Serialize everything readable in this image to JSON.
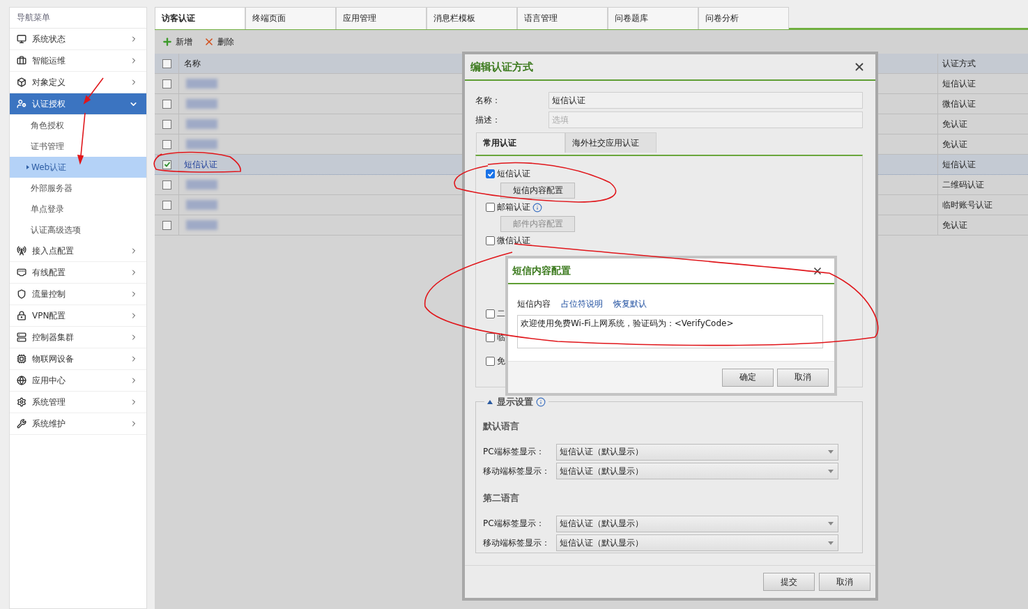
{
  "sidebar": {
    "title": "导航菜单",
    "items": [
      {
        "label": "系统状态",
        "expanded": false
      },
      {
        "label": "智能运维",
        "expanded": false
      },
      {
        "label": "对象定义",
        "expanded": false
      },
      {
        "label": "认证授权",
        "expanded": true,
        "children": [
          {
            "label": "角色授权",
            "selected": false
          },
          {
            "label": "证书管理",
            "selected": false
          },
          {
            "label": "Web认证",
            "selected": true
          },
          {
            "label": "外部服务器",
            "selected": false
          },
          {
            "label": "单点登录",
            "selected": false
          },
          {
            "label": "认证高级选项",
            "selected": false
          }
        ]
      },
      {
        "label": "接入点配置",
        "expanded": false
      },
      {
        "label": "有线配置",
        "expanded": false
      },
      {
        "label": "流量控制",
        "expanded": false
      },
      {
        "label": "VPN配置",
        "expanded": false
      },
      {
        "label": "控制器集群",
        "expanded": false
      },
      {
        "label": "物联网设备",
        "expanded": false
      },
      {
        "label": "应用中心",
        "expanded": false
      },
      {
        "label": "系统管理",
        "expanded": false
      },
      {
        "label": "系统维护",
        "expanded": false
      }
    ]
  },
  "tabs": [
    {
      "label": "访客认证",
      "selected": true
    },
    {
      "label": "终端页面",
      "selected": false
    },
    {
      "label": "应用管理",
      "selected": false
    },
    {
      "label": "消息栏模板",
      "selected": false
    },
    {
      "label": "语言管理",
      "selected": false
    },
    {
      "label": "问卷题库",
      "selected": false
    },
    {
      "label": "问卷分析",
      "selected": false
    }
  ],
  "toolbar": [
    {
      "kind": "add",
      "label": "新增"
    },
    {
      "kind": "delete",
      "label": "删除"
    }
  ],
  "table": {
    "header_checked": false,
    "columns": [
      "名称",
      "认证方式"
    ],
    "rows": [
      {
        "checked": false,
        "selected": false,
        "redacted": true,
        "method": "短信认证"
      },
      {
        "checked": false,
        "selected": false,
        "redacted": true,
        "method": "微信认证"
      },
      {
        "checked": false,
        "selected": false,
        "redacted": true,
        "method": "免认证"
      },
      {
        "checked": false,
        "selected": false,
        "redacted": true,
        "method": "免认证"
      },
      {
        "checked": true,
        "selected": true,
        "redacted": false,
        "name": "短信认证",
        "method": "短信认证"
      },
      {
        "checked": false,
        "selected": false,
        "redacted": true,
        "method": "二维码认证"
      },
      {
        "checked": false,
        "selected": false,
        "redacted": true,
        "method": "临时账号认证"
      },
      {
        "checked": false,
        "selected": false,
        "redacted": true,
        "method": "免认证"
      }
    ]
  },
  "dialog": {
    "title": "编辑认证方式",
    "name_label": "名称：",
    "name_value": "短信认证",
    "desc_label": "描述：",
    "desc_placeholder": "选填",
    "tabs": [
      {
        "label": "常用认证",
        "selected": true
      },
      {
        "label": "海外社交应用认证",
        "selected": false
      }
    ],
    "options": [
      {
        "label": "短信认证",
        "checked": true,
        "info": false,
        "button": {
          "label": "短信内容配置",
          "disabled": false
        }
      },
      {
        "label": "邮箱认证",
        "checked": false,
        "info": true,
        "button": {
          "label": "邮件内容配置",
          "disabled": true
        }
      },
      {
        "label": "微信认证",
        "checked": false,
        "info": false
      },
      {
        "label": "二",
        "checked": false,
        "info": false
      },
      {
        "label": "临",
        "checked": false,
        "info": false
      },
      {
        "label": "免",
        "checked": false,
        "info": false
      }
    ],
    "display": {
      "legend": "显示设置",
      "expanded": true,
      "sections": [
        {
          "title": "默认语言",
          "rows": [
            {
              "label": "PC端标签显示：",
              "value": "短信认证（默认显示）"
            },
            {
              "label": "移动端标签显示：",
              "value": "短信认证（默认显示）"
            }
          ]
        },
        {
          "title": "第二语言",
          "rows": [
            {
              "label": "PC端标签显示：",
              "value": "短信认证（默认显示）"
            },
            {
              "label": "移动端标签显示：",
              "value": "短信认证（默认显示）"
            }
          ]
        }
      ]
    },
    "buttons": [
      "提交",
      "取消"
    ]
  },
  "sms_dialog": {
    "title": "短信内容配置",
    "label": "短信内容",
    "links": [
      "占位符说明",
      "恢复默认"
    ],
    "content": "欢迎使用免费Wi-Fi上网系统，验证码为：<VerifyCode>",
    "buttons": [
      "确定",
      "取消"
    ]
  }
}
